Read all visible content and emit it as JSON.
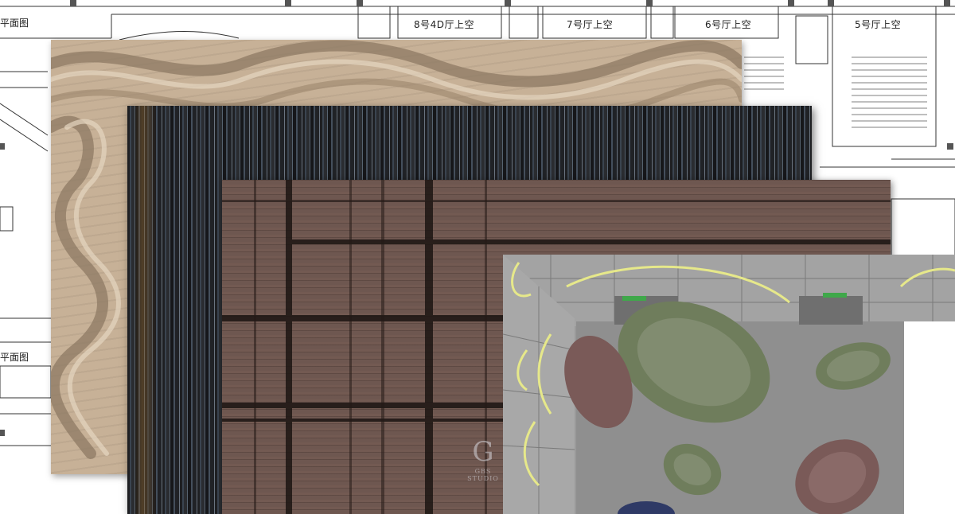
{
  "plan": {
    "title_fragment": "平面图",
    "caption_left": "平面图",
    "hall_labels": [
      "8号4D厅上空",
      "7号厅上空",
      "6号厅上空",
      "5号厅上空"
    ]
  },
  "swatches": [
    {
      "name": "wave-pattern",
      "color": "#c7b197"
    },
    {
      "name": "dark-streak",
      "color": "#2a2c30"
    },
    {
      "name": "brown-crosshatch",
      "color": "#6e5750"
    }
  ],
  "render": {
    "note": "",
    "wall_color": "#9a9a9a",
    "floor_color": "#8f8f8f",
    "accent_light": "#e6e88a",
    "blob_colors": [
      "#6f7d5c",
      "#7a5a58",
      "#2f3a66"
    ]
  },
  "watermark": {
    "mark": "G",
    "word": "GBS STUDIO"
  }
}
